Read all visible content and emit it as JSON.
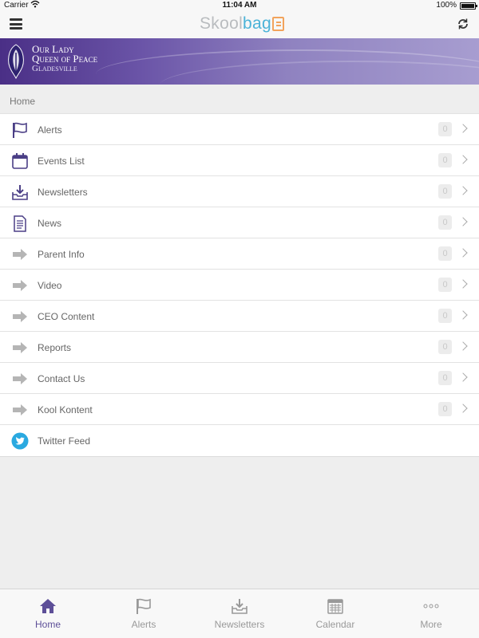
{
  "status_bar": {
    "carrier": "Carrier",
    "time": "11:04 AM",
    "battery": "100%"
  },
  "nav": {
    "brand_part1": "Skool",
    "brand_part2": "bag"
  },
  "banner": {
    "line1": "Our Lady",
    "line2": "Queen of Peace",
    "line3": "Gladesville"
  },
  "breadcrumb": "Home",
  "menu": [
    {
      "label": "Alerts",
      "count": "0",
      "icon": "flag-icon"
    },
    {
      "label": "Events List",
      "count": "0",
      "icon": "calendar-icon"
    },
    {
      "label": "Newsletters",
      "count": "0",
      "icon": "inbox-download-icon"
    },
    {
      "label": "News",
      "count": "0",
      "icon": "document-icon"
    },
    {
      "label": "Parent Info",
      "count": "0",
      "icon": "arrow-right-icon"
    },
    {
      "label": "Video",
      "count": "0",
      "icon": "arrow-right-icon"
    },
    {
      "label": "CEO Content",
      "count": "0",
      "icon": "arrow-right-icon"
    },
    {
      "label": "Reports",
      "count": "0",
      "icon": "arrow-right-icon"
    },
    {
      "label": "Contact Us",
      "count": "0",
      "icon": "arrow-right-icon"
    },
    {
      "label": "Kool Kontent",
      "count": "0",
      "icon": "arrow-right-icon"
    },
    {
      "label": "Twitter Feed",
      "icon": "twitter-icon"
    }
  ],
  "tabs": [
    {
      "label": "Home",
      "icon": "home-icon",
      "active": true
    },
    {
      "label": "Alerts",
      "icon": "flag-icon"
    },
    {
      "label": "Newsletters",
      "icon": "inbox-download-icon"
    },
    {
      "label": "Calendar",
      "icon": "calendar-icon"
    },
    {
      "label": "More",
      "icon": "more-dots-icon"
    }
  ],
  "colors": {
    "accent": "#5d4f98",
    "banner": "#6b55a8",
    "brand_blue": "#4bb3d8",
    "brand_orange": "#f2a35c",
    "twitter": "#2aa9e0"
  }
}
